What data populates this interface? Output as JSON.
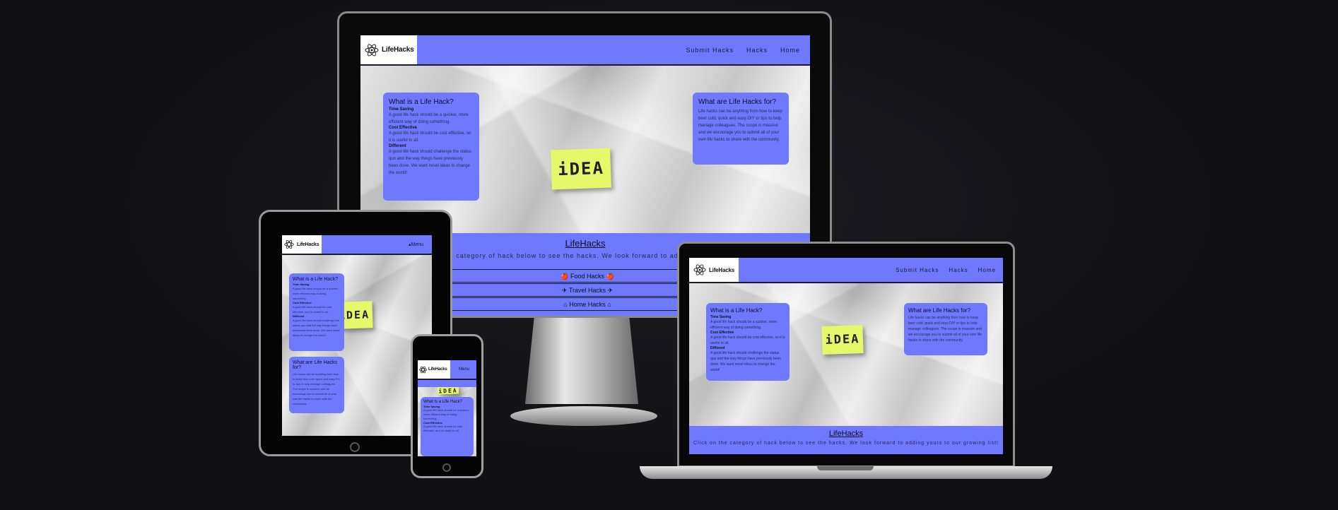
{
  "brand": {
    "name": "LifeHacks",
    "accent": "#6e79ff"
  },
  "nav": {
    "submit": "Submit Hacks",
    "hacks": "Hacks",
    "home": "Home",
    "menu": "Menu"
  },
  "what_is": {
    "title": "What is a Life Hack?",
    "h1": "Time Saving",
    "p1": "A good life hack should be a quicker, more efficient way of doing something.",
    "h2": "Cost Effective",
    "p2": "A good life hack should be cost effective, so it is useful to all.",
    "h3": "Different",
    "p3": "A good life hack should challenge the status quo and the way things have previously been done. We want novel ideas to change the world!"
  },
  "what_for": {
    "title": "What are Life Hacks for?",
    "text": "Life hacks can be anything from how to keep beer cold, quick and easy DIY or tips to help manage colleagues. The scope is massive and we encourage you to submit all of your own life hacks to share with the community."
  },
  "sticky": "iDEA",
  "footer": {
    "title": "LifeHacks",
    "text": "Click on the category of hack below to see the hacks. We look forward to adding yours to our growing list!",
    "text_partial": "category of hack below to see the hacks. We look forward to adding"
  },
  "hacks": [
    {
      "label": "Food Hacks",
      "icon": "apple-icon"
    },
    {
      "label": "Travel Hacks",
      "icon": "plane-icon"
    },
    {
      "label": "Home Hacks",
      "icon": "home-icon"
    }
  ]
}
